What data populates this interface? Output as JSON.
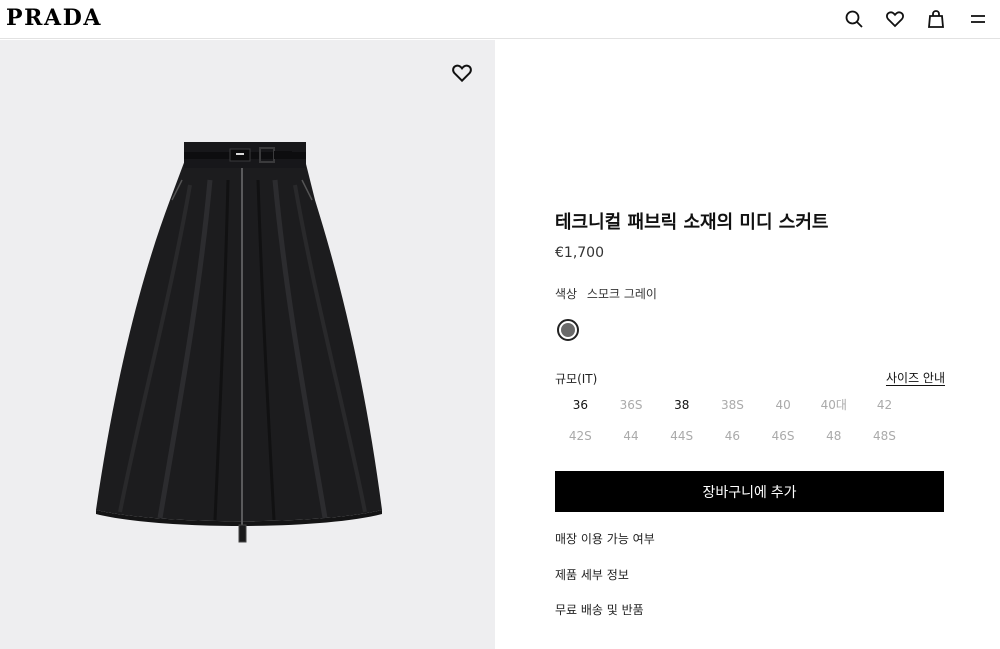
{
  "header": {
    "logo": "PRADA",
    "icons": [
      "search-icon",
      "heart-icon",
      "shopping-bag-icon",
      "menu-icon"
    ]
  },
  "product": {
    "title": "테크니컬 패브릭 소재의 미디 스커트",
    "price": "€1,700",
    "color_label": "색상",
    "color_value": "스모크 그레이",
    "swatch_color": "#6a6a6a",
    "size_label": "규모(IT)",
    "size_guide": "사이즈 안내",
    "sizes": [
      {
        "label": "36",
        "available": true
      },
      {
        "label": "36S",
        "available": false
      },
      {
        "label": "38",
        "available": true
      },
      {
        "label": "38S",
        "available": false
      },
      {
        "label": "40",
        "available": false
      },
      {
        "label": "40대",
        "available": false
      },
      {
        "label": "42",
        "available": false
      },
      {
        "label": "42S",
        "available": false
      },
      {
        "label": "44",
        "available": false
      },
      {
        "label": "44S",
        "available": false
      },
      {
        "label": "46",
        "available": false
      },
      {
        "label": "46S",
        "available": false
      },
      {
        "label": "48",
        "available": false
      },
      {
        "label": "48S",
        "available": false
      }
    ],
    "add_to_cart": "장바구니에 추가",
    "links": {
      "store_availability": "매장 이용 가능 여부",
      "product_details": "제품 세부 정보",
      "free_shipping": "무료 배송 및 반품"
    }
  },
  "colors": {
    "image_bg": "#eeeef0",
    "button_bg": "#000000",
    "button_text": "#ffffff"
  }
}
